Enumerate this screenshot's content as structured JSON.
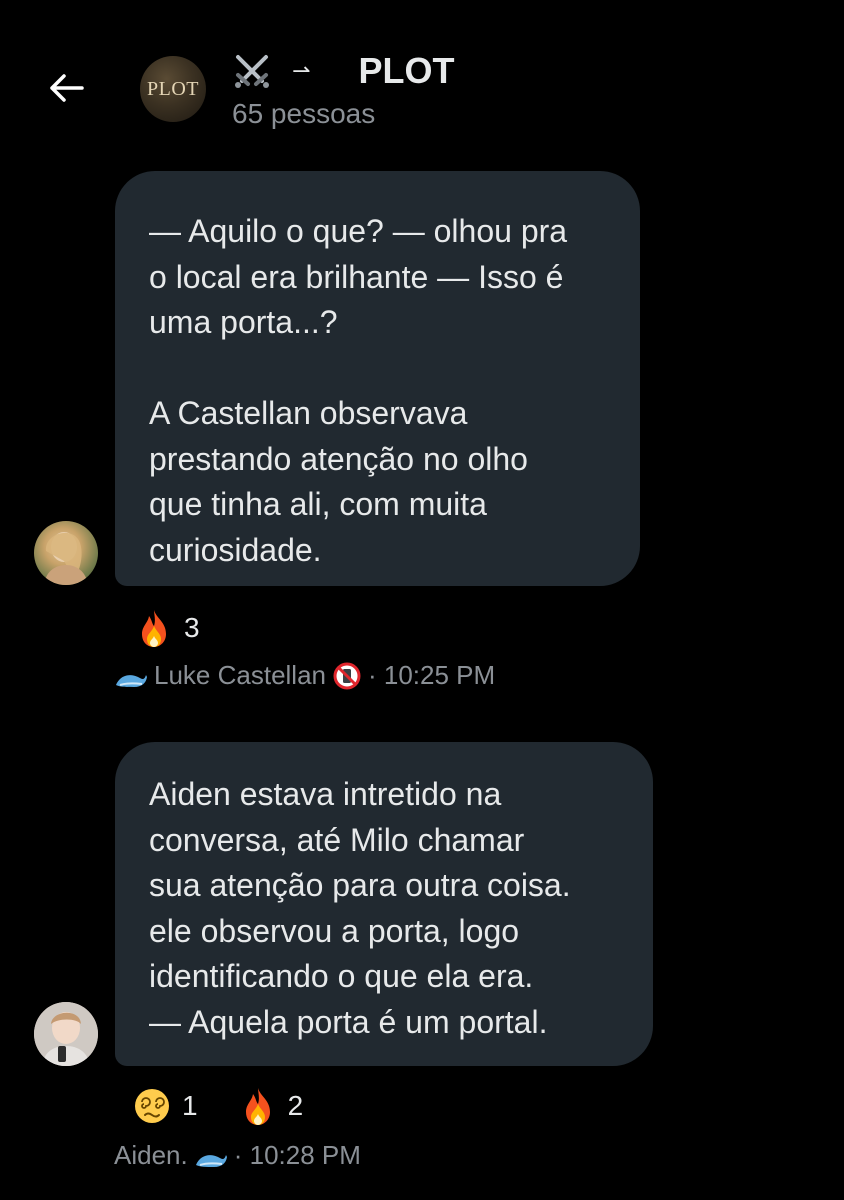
{
  "header": {
    "title": "PLOT",
    "avatar_text": "PLOT",
    "title_prefix_icons": [
      "crossed-swords",
      "right-arrow"
    ],
    "arrow_glyph": "⇀",
    "member_count": "65 pessoas"
  },
  "messages": [
    {
      "lines": [
        "— Aquilo o que? — olhou pra",
        "o local era brilhante — Isso é",
        "uma porta...?",
        "",
        "A Castellan observava",
        "prestando atenção no olho",
        "que tinha ali, com muita",
        "curiosidade."
      ],
      "reactions": [
        {
          "emoji": "fire",
          "count": "3"
        }
      ],
      "sender": "Luke Castellan",
      "sender_prefix_icon": "whale",
      "sender_suffix_icon": "no-mobile-phones",
      "time": "· 10:25 PM"
    },
    {
      "lines": [
        "Aiden estava intretido na",
        "conversa, até Milo chamar",
        "sua atenção para outra coisa.",
        "ele observou a porta, logo",
        "identificando o que ela era.",
        "— Aquela porta é um portal."
      ],
      "reactions": [
        {
          "emoji": "dizzy-face",
          "count": "1"
        },
        {
          "emoji": "fire",
          "count": "2"
        }
      ],
      "sender": "Aiden.",
      "sender_suffix_icon": "whale",
      "time": "· 10:28 PM"
    }
  ],
  "colors": {
    "background": "#000000",
    "bubble": "#212930",
    "text": "#e7e9ea",
    "muted": "#8b9096"
  }
}
